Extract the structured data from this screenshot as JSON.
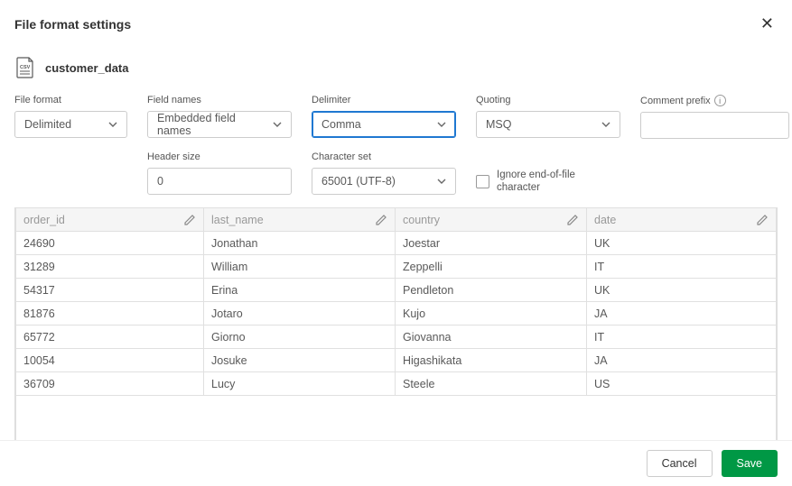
{
  "header": {
    "title": "File format settings"
  },
  "file": {
    "name": "customer_data"
  },
  "fields": {
    "file_format": {
      "label": "File format",
      "value": "Delimited"
    },
    "field_names": {
      "label": "Field names",
      "value": "Embedded field names"
    },
    "delimiter": {
      "label": "Delimiter",
      "value": "Comma"
    },
    "quoting": {
      "label": "Quoting",
      "value": "MSQ"
    },
    "comment_prefix": {
      "label": "Comment prefix",
      "value": ""
    },
    "header_size": {
      "label": "Header size",
      "value": "0"
    },
    "character_set": {
      "label": "Character set",
      "value": "65001 (UTF-8)"
    },
    "ignore_eof": {
      "label": "Ignore end-of-file character",
      "checked": false
    }
  },
  "table": {
    "columns": [
      "order_id",
      "last_name",
      "country",
      "date"
    ],
    "rows": [
      [
        "24690",
        "Jonathan",
        "Joestar",
        "UK"
      ],
      [
        "31289",
        "William",
        "Zeppelli",
        "IT"
      ],
      [
        "54317",
        "Erina",
        "Pendleton",
        "UK"
      ],
      [
        "81876",
        "Jotaro",
        "Kujo",
        "JA"
      ],
      [
        "65772",
        "Giorno",
        "Giovanna",
        "IT"
      ],
      [
        "10054",
        "Josuke",
        "Higashikata",
        "JA"
      ],
      [
        "36709",
        "Lucy",
        "Steele",
        "US"
      ]
    ]
  },
  "footer": {
    "cancel": "Cancel",
    "save": "Save"
  }
}
